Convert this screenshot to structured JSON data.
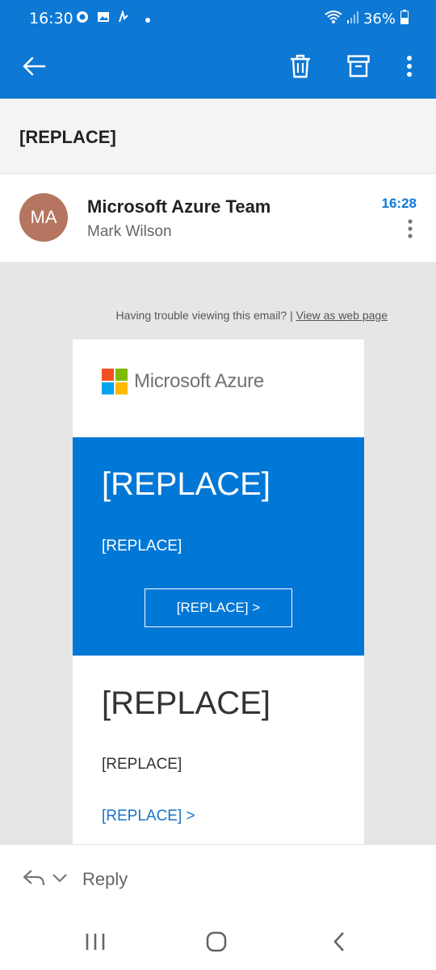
{
  "status_bar": {
    "time": "16:30",
    "battery": "36%",
    "left_icons": [
      "chat-bubble-icon",
      "image-icon",
      "activity-icon",
      "dot-icon"
    ],
    "right_icons": [
      "wifi-icon",
      "signal-icon",
      "battery-icon"
    ]
  },
  "app_bar": {
    "icons": [
      "back-arrow-icon",
      "trash-icon",
      "archive-icon",
      "more-vertical-icon"
    ],
    "color": "#0e78d5"
  },
  "message": {
    "subject": "[REPLACE]",
    "sender_initials": "MA",
    "sender_name": "Microsoft Azure Team",
    "recipient": "Mark Wilson",
    "time": "16:28",
    "avatar_color": "#b57560"
  },
  "email_body": {
    "trouble_text": "Having trouble viewing this email? |",
    "web_link": "View as web page",
    "logo_text": "Microsoft Azure",
    "logo_colors": [
      "#f25022",
      "#7fba00",
      "#00a4ef",
      "#ffb900"
    ],
    "hero": {
      "title": "[REPLACE]",
      "text": "[REPLACE]",
      "button": "[REPLACE] >",
      "color": "#0177d6"
    },
    "section": {
      "title": "[REPLACE]",
      "text": "[REPLACE]",
      "link": "[REPLACE] >"
    }
  },
  "reply_bar": {
    "label": "Reply",
    "icons": [
      "reply-arrow-icon",
      "chevron-down-icon"
    ]
  },
  "nav_bar": {
    "icons": [
      "recents-icon",
      "home-icon",
      "back-icon"
    ]
  }
}
